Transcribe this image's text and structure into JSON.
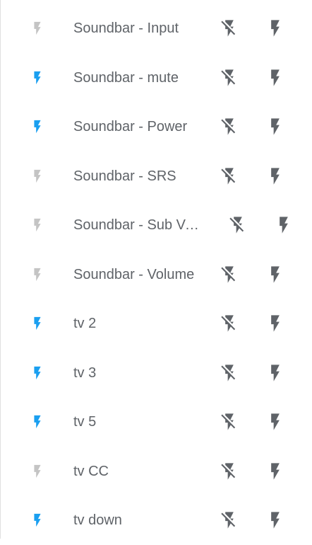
{
  "colors": {
    "active": "#1a9ff0",
    "inactive": "#c4c4c4",
    "button_icon": "#5f6368",
    "text": "#5f6368"
  },
  "entities": [
    {
      "label": "Soundbar - Input",
      "state": "off",
      "off_icon": "flash-off-icon",
      "on_icon": "flash-on-icon"
    },
    {
      "label": "Soundbar - mute",
      "state": "on",
      "off_icon": "flash-off-icon",
      "on_icon": "flash-on-icon"
    },
    {
      "label": "Soundbar - Power",
      "state": "on",
      "off_icon": "flash-off-icon",
      "on_icon": "flash-on-icon"
    },
    {
      "label": "Soundbar - SRS",
      "state": "off",
      "off_icon": "flash-off-icon",
      "on_icon": "flash-on-icon"
    },
    {
      "label": "Soundbar - Sub Vo…",
      "state": "off",
      "off_icon": "flash-off-icon",
      "on_icon": "flash-on-icon"
    },
    {
      "label": "Soundbar - Volume",
      "state": "off",
      "off_icon": "flash-off-icon",
      "on_icon": "flash-on-icon"
    },
    {
      "label": "tv 2",
      "state": "on",
      "off_icon": "flash-off-icon",
      "on_icon": "flash-on-icon"
    },
    {
      "label": "tv 3",
      "state": "on",
      "off_icon": "flash-off-icon",
      "on_icon": "flash-on-icon"
    },
    {
      "label": "tv 5",
      "state": "on",
      "off_icon": "flash-off-icon",
      "on_icon": "flash-on-icon"
    },
    {
      "label": "tv CC",
      "state": "off",
      "off_icon": "flash-off-icon",
      "on_icon": "flash-on-icon"
    },
    {
      "label": "tv down",
      "state": "on",
      "off_icon": "flash-off-icon",
      "on_icon": "flash-on-icon"
    }
  ]
}
